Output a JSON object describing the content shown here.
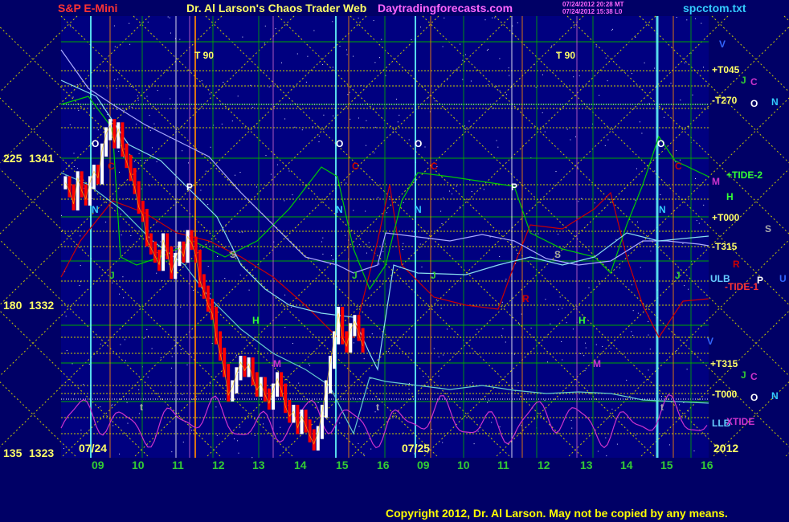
{
  "header": {
    "instrument": "S&P E-Mini",
    "title": "Dr. Al Larson's Chaos Trader Web",
    "site": "Daytradingforecasts.com",
    "stamp1": "07/24/2012 20:28 MT",
    "stamp2": "07/24/2012 15:38 L0",
    "file": "spcctom.txt",
    "copyright": "Copyright 2012, Dr. Al Larson. May not be copied by any means."
  },
  "colors": {
    "background": "#000066",
    "plot_bg": "#000080",
    "price_up": "#ffffff",
    "price_down": "#ff0000",
    "grid_yellow": "#cccc00",
    "grid_green": "#00aa00",
    "tide1": "#cc0000",
    "tide2": "#00cc00",
    "xtide": "#cc33cc",
    "ulb": "#66cccc",
    "cyan_vert": "#66ffff",
    "orange_vert": "#ff8800",
    "magenta_vert": "#cc66cc"
  },
  "chart_data": {
    "type": "candlestick",
    "title": "S&P E-Mini",
    "y_axis_left": [
      {
        "deg": "225",
        "price": "1341"
      },
      {
        "deg": "180",
        "price": "1332"
      },
      {
        "deg": "135",
        "price": "1323"
      }
    ],
    "ylim": [
      1323,
      1341
    ],
    "x_day_labels": [
      "07/24",
      "07/25"
    ],
    "x_hour_labels": [
      "09",
      "10",
      "11",
      "12",
      "13",
      "14",
      "15",
      "16",
      "09",
      "10",
      "11",
      "12",
      "13",
      "14",
      "15",
      "16"
    ],
    "year_label": "2012",
    "right_labels": [
      {
        "text": "V",
        "color": "#3366ff"
      },
      {
        "text": "+T045",
        "color": "#ffff66"
      },
      {
        "text": "J",
        "color": "#33cc33"
      },
      {
        "text": "C",
        "color": "#cc33cc"
      },
      {
        "text": "-T270",
        "color": "#ffff66"
      },
      {
        "text": "O",
        "color": "#ffffff"
      },
      {
        "text": "N",
        "color": "#33ccff"
      },
      {
        "text": "+TIDE-2",
        "color": "#33ff33"
      },
      {
        "text": "M",
        "color": "#cc33cc"
      },
      {
        "text": "H",
        "color": "#33ff33"
      },
      {
        "text": "+T000",
        "color": "#ffff66"
      },
      {
        "text": "S",
        "color": "#aaaaaa"
      },
      {
        "text": "-T315",
        "color": "#ffff66"
      },
      {
        "text": "R",
        "color": "#cc0000"
      },
      {
        "text": "ULB",
        "color": "#66ccff"
      },
      {
        "text": "P",
        "color": "#ffffff"
      },
      {
        "text": "U",
        "color": "#3366ff"
      },
      {
        "text": "-TIDE-1",
        "color": "#ff3333"
      },
      {
        "text": "V",
        "color": "#3366ff"
      },
      {
        "text": "+T315",
        "color": "#ffff66"
      },
      {
        "text": "J",
        "color": "#33cc33"
      },
      {
        "text": "C",
        "color": "#cc33cc"
      },
      {
        "text": "-T000",
        "color": "#ffff66"
      },
      {
        "text": "O",
        "color": "#ffffff"
      },
      {
        "text": "N",
        "color": "#33ccff"
      },
      {
        "text": "LLB",
        "color": "#66ccff"
      },
      {
        "text": "XTIDE",
        "color": "#cc33cc"
      }
    ],
    "chart_markers": [
      {
        "text": "T 90",
        "color": "#ffff66"
      },
      {
        "text": "T 90",
        "color": "#ffff66"
      },
      {
        "text": "O",
        "color": "#ffffff"
      },
      {
        "text": "O",
        "color": "#ffffff"
      },
      {
        "text": "O",
        "color": "#ffffff"
      },
      {
        "text": "O",
        "color": "#ffffff"
      },
      {
        "text": "C",
        "color": "#cc0000"
      },
      {
        "text": "C",
        "color": "#cc0000"
      },
      {
        "text": "C",
        "color": "#cc0000"
      },
      {
        "text": "C",
        "color": "#cc0000"
      },
      {
        "text": "P",
        "color": "#ffffff"
      },
      {
        "text": "P",
        "color": "#ffffff"
      },
      {
        "text": "N",
        "color": "#33ccff"
      },
      {
        "text": "N",
        "color": "#33ccff"
      },
      {
        "text": "N",
        "color": "#33ccff"
      },
      {
        "text": "N",
        "color": "#33ccff"
      },
      {
        "text": "S",
        "color": "#aaaaaa"
      },
      {
        "text": "S",
        "color": "#aaaaaa"
      },
      {
        "text": "J",
        "color": "#33cc33"
      },
      {
        "text": "J",
        "color": "#33cc33"
      },
      {
        "text": "J",
        "color": "#33cc33"
      },
      {
        "text": "J",
        "color": "#33cc33"
      },
      {
        "text": "H",
        "color": "#33ff33"
      },
      {
        "text": "H",
        "color": "#33ff33"
      },
      {
        "text": "M",
        "color": "#cc33cc"
      },
      {
        "text": "M",
        "color": "#cc33cc"
      },
      {
        "text": "R",
        "color": "#cc0000"
      },
      {
        "text": "t",
        "color": "#aaaaaa"
      },
      {
        "text": "t",
        "color": "#aaaaaa"
      },
      {
        "text": "t",
        "color": "#aaaaaa"
      }
    ],
    "price_series": [
      1339.5,
      1339.0,
      1338.2,
      1339.8,
      1339.0,
      1338.5,
      1339.5,
      1340.2,
      1339.8,
      1341.5,
      1342.5,
      1343.0,
      1342.0,
      1342.8,
      1341.5,
      1340.8,
      1340.0,
      1339.2,
      1338.0,
      1337.5,
      1336.0,
      1335.5,
      1335.0,
      1334.5,
      1336.0,
      1335.2,
      1334.0,
      1334.8,
      1335.5,
      1335.0,
      1336.2,
      1335.8,
      1335.0,
      1333.5,
      1332.8,
      1332.0,
      1331.5,
      1330.0,
      1329.0,
      1328.0,
      1326.5,
      1327.0,
      1327.8,
      1328.5,
      1328.0,
      1328.4,
      1327.5,
      1326.8,
      1327.2,
      1326.5,
      1326.0,
      1326.8,
      1327.5,
      1326.8,
      1325.8,
      1325.2,
      1325.5,
      1324.5,
      1325.2,
      1324.6,
      1324.0,
      1323.5,
      1324.2,
      1325.5,
      1327.0,
      1328.5,
      1330.0,
      1331.5,
      1330.0,
      1329.5,
      1330.5,
      1331.0,
      1330.2,
      1329.5
    ],
    "price_times": [
      8.2,
      8.3,
      8.4,
      8.5,
      8.6,
      8.7,
      8.8,
      8.9,
      9.0,
      9.1,
      9.2,
      9.3,
      9.4,
      9.5,
      9.6,
      9.7,
      9.8,
      9.9,
      10.0,
      10.1,
      10.2,
      10.3,
      10.4,
      10.5,
      10.6,
      10.7,
      10.8,
      10.9,
      11.0,
      11.1,
      11.2,
      11.3,
      11.4,
      11.5,
      11.6,
      11.7,
      11.8,
      11.9,
      12.0,
      12.1,
      12.2,
      12.3,
      12.4,
      12.5,
      12.6,
      12.7,
      12.8,
      12.9,
      13.0,
      13.1,
      13.2,
      13.3,
      13.4,
      13.5,
      13.6,
      13.7,
      13.8,
      13.9,
      14.0,
      14.1,
      14.2,
      14.3,
      14.4,
      14.5,
      14.6,
      14.7,
      14.8,
      14.9,
      15.0,
      15.1,
      15.2,
      15.3,
      15.4,
      15.5
    ]
  }
}
